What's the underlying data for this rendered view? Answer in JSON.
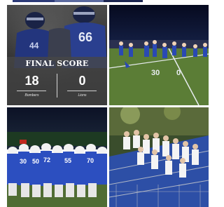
{
  "grid": {
    "tile1": {
      "kind": "final-score-graphic",
      "photo_desc": "football players in blue jerseys (number 66) under stadium lights",
      "jersey_number": "66",
      "final_label": "FINAL SCORE",
      "home_score": "18",
      "home_team": "Bombers",
      "away_score": "0",
      "away_team": "Lions"
    },
    "tile2": {
      "kind": "photo",
      "desc": "cheerleaders in blue performing on football field at night near 30-yard line",
      "yard_marker": "30"
    },
    "tile3": {
      "kind": "photo",
      "desc": "football team in blue jerseys and white helmets gathered on field at night"
    },
    "tile4": {
      "kind": "photo",
      "desc": "crowd of fans in white shirts cheering in the bleachers"
    }
  },
  "colors": {
    "team_blue": "#2a49b3",
    "score_panel": "#464646",
    "field_green": "#5f7f3a",
    "night_sky": "#0a0f2a"
  }
}
